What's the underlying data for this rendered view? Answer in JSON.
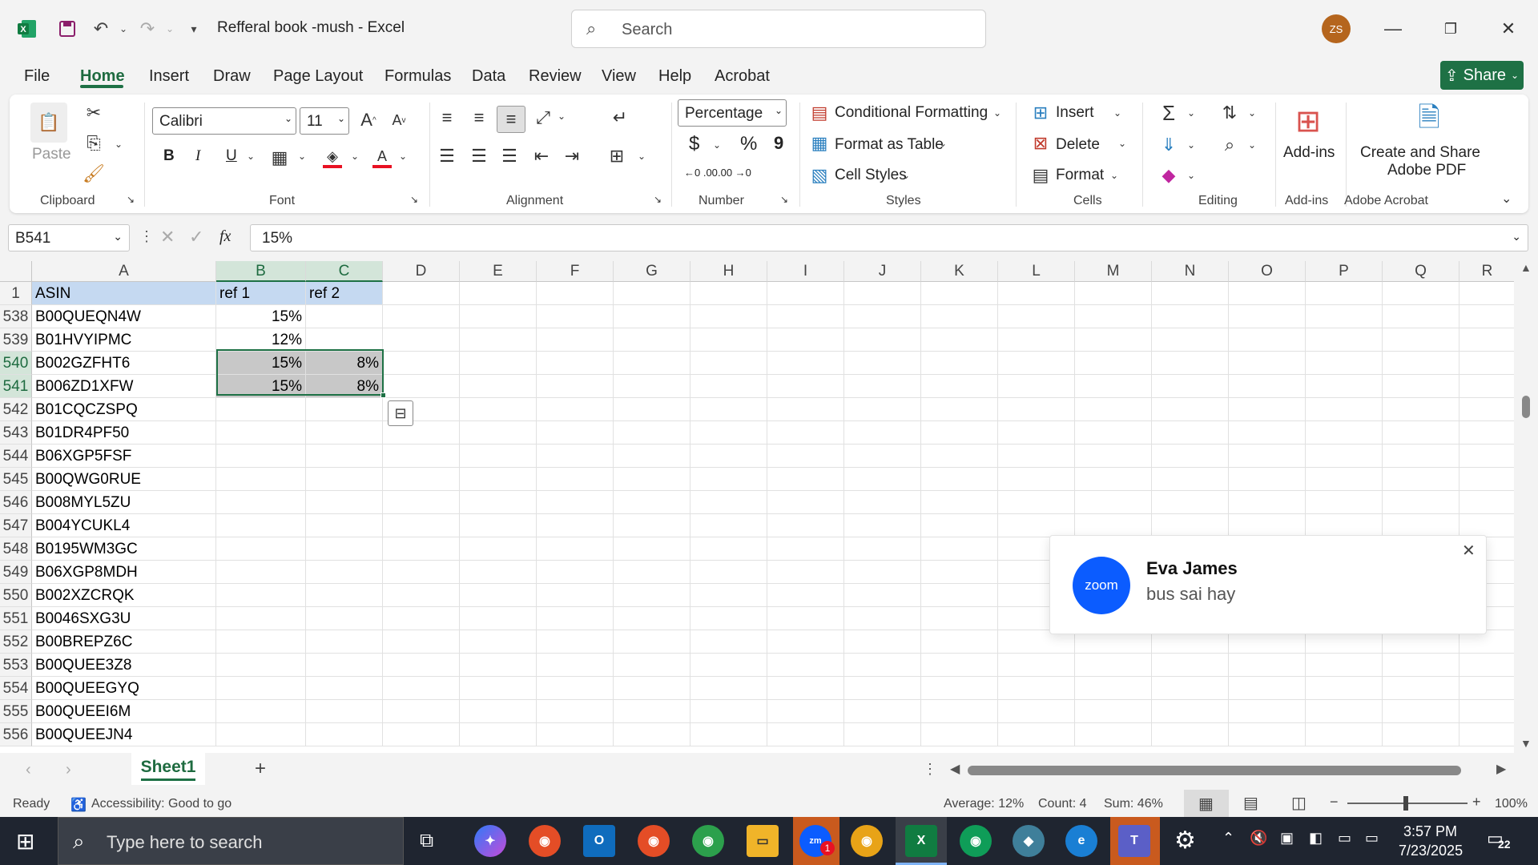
{
  "app": {
    "title": "Refferal book -mush  -  Excel",
    "search_placeholder": "Search",
    "avatar_initials": "ZS",
    "accent_color": "#1e7145"
  },
  "menu": {
    "tabs": [
      "File",
      "Home",
      "Insert",
      "Draw",
      "Page Layout",
      "Formulas",
      "Data",
      "Review",
      "View",
      "Help",
      "Acrobat"
    ],
    "active": "Home",
    "share_label": "Share"
  },
  "ribbon": {
    "clipboard": {
      "paste": "Paste",
      "group": "Clipboard"
    },
    "font": {
      "name": "Calibri",
      "size": "11",
      "bold": "B",
      "italic": "I",
      "underline": "U",
      "group": "Font"
    },
    "alignment": {
      "group": "Alignment"
    },
    "number": {
      "format": "Percentage",
      "currency": "$",
      "percent": "%",
      "comma": "9",
      "inc_decimal": "←0 .00",
      "dec_decimal": ".00 →0",
      "group": "Number"
    },
    "styles": {
      "conditional": "Conditional Formatting",
      "format_table": "Format as Table",
      "cell_styles": "Cell Styles",
      "group": "Styles"
    },
    "cells": {
      "insert": "Insert",
      "delete": "Delete",
      "format": "Format",
      "group": "Cells"
    },
    "editing": {
      "group": "Editing"
    },
    "addins": {
      "label": "Add-ins",
      "group": "Add-ins"
    },
    "acrobat": {
      "label_line1": "Create and Share",
      "label_line2": "Adobe PDF",
      "group": "Adobe Acrobat"
    }
  },
  "formula_bar": {
    "name_box": "B541",
    "fx": "fx",
    "value": "15%"
  },
  "grid": {
    "columns": [
      "A",
      "B",
      "C",
      "D",
      "E",
      "F",
      "G",
      "H",
      "I",
      "J",
      "K",
      "L",
      "M",
      "N",
      "O",
      "P",
      "Q",
      "R"
    ],
    "header_row": {
      "row": "1",
      "a": "ASIN",
      "b": "ref 1",
      "c": "ref 2"
    },
    "rows": [
      {
        "row": "538",
        "a": "B00QUEQN4W",
        "b": "15%",
        "c": ""
      },
      {
        "row": "539",
        "a": "B01HVYIPMC",
        "b": "12%",
        "c": ""
      },
      {
        "row": "540",
        "a": "B002GZFHT6",
        "b": "15%",
        "c": "8%"
      },
      {
        "row": "541",
        "a": "B006ZD1XFW",
        "b": "15%",
        "c": "8%"
      },
      {
        "row": "542",
        "a": "B01CQCZSPQ",
        "b": "",
        "c": ""
      },
      {
        "row": "543",
        "a": "B01DR4PF50",
        "b": "",
        "c": ""
      },
      {
        "row": "544",
        "a": "B06XGP5FSF",
        "b": "",
        "c": ""
      },
      {
        "row": "545",
        "a": "B00QWG0RUE",
        "b": "",
        "c": ""
      },
      {
        "row": "546",
        "a": "B008MYL5ZU",
        "b": "",
        "c": ""
      },
      {
        "row": "547",
        "a": "B004YCUKL4",
        "b": "",
        "c": ""
      },
      {
        "row": "548",
        "a": "B0195WM3GC",
        "b": "",
        "c": ""
      },
      {
        "row": "549",
        "a": "B06XGP8MDH",
        "b": "",
        "c": ""
      },
      {
        "row": "550",
        "a": "B002XZCRQK",
        "b": "",
        "c": ""
      },
      {
        "row": "551",
        "a": "B0046SXG3U",
        "b": "",
        "c": ""
      },
      {
        "row": "552",
        "a": "B00BREPZ6C",
        "b": "",
        "c": ""
      },
      {
        "row": "553",
        "a": "B00QUEE3Z8",
        "b": "",
        "c": ""
      },
      {
        "row": "554",
        "a": "B00QUEEGYQ",
        "b": "",
        "c": ""
      },
      {
        "row": "555",
        "a": "B00QUEEI6M",
        "b": "",
        "c": ""
      },
      {
        "row": "556",
        "a": "B00QUEEJN4",
        "b": "",
        "c": ""
      }
    ]
  },
  "sheets": {
    "tabs": [
      "Sheet1"
    ],
    "active": "Sheet1",
    "add": "+"
  },
  "status": {
    "mode": "Ready",
    "accessibility": "Accessibility: Good to go",
    "average": "Average: 12%",
    "count": "Count: 4",
    "sum": "Sum: 46%",
    "zoom": "100%"
  },
  "notification": {
    "app": "zoom",
    "sender": "Eva James",
    "message": "bus sai hay"
  },
  "taskbar": {
    "search_placeholder": "Type here to search",
    "time": "3:57 PM",
    "date": "7/23/2025",
    "notification_count": "22",
    "zoom_badge": "1"
  }
}
